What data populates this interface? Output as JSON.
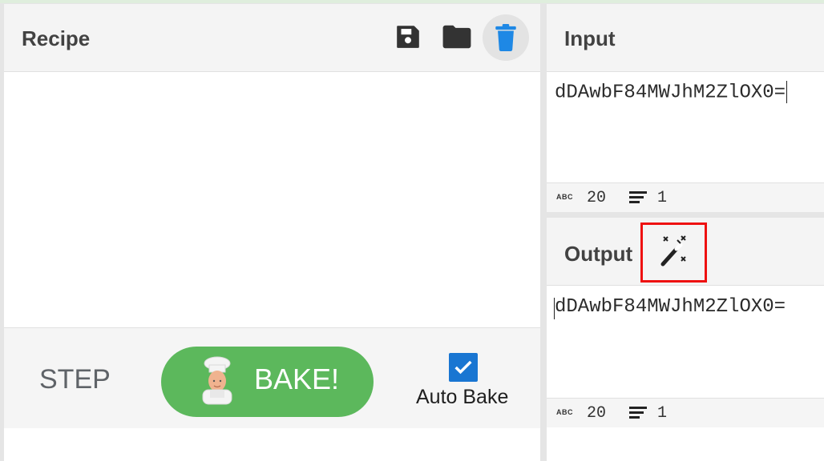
{
  "recipe": {
    "title": "Recipe",
    "step_label": "STEP",
    "bake_label": "BAKE!",
    "auto_bake_label": "Auto Bake",
    "auto_bake_checked": true
  },
  "input": {
    "title": "Input",
    "text": "dDAwbF84MWJhM2ZlOX0=",
    "char_count": "20",
    "line_count": "1"
  },
  "output": {
    "title": "Output",
    "text": "dDAwbF84MWJhM2ZlOX0=",
    "char_count": "20",
    "line_count": "1"
  },
  "status_label": "ABC",
  "icons": {
    "save": "save-icon",
    "folder": "folder-icon",
    "trash": "trash-icon",
    "magic": "magic-wand-icon",
    "lines": "lines-icon"
  },
  "colors": {
    "bake": "#5cb85c",
    "accent": "#1976d2",
    "highlight": "#e11"
  }
}
